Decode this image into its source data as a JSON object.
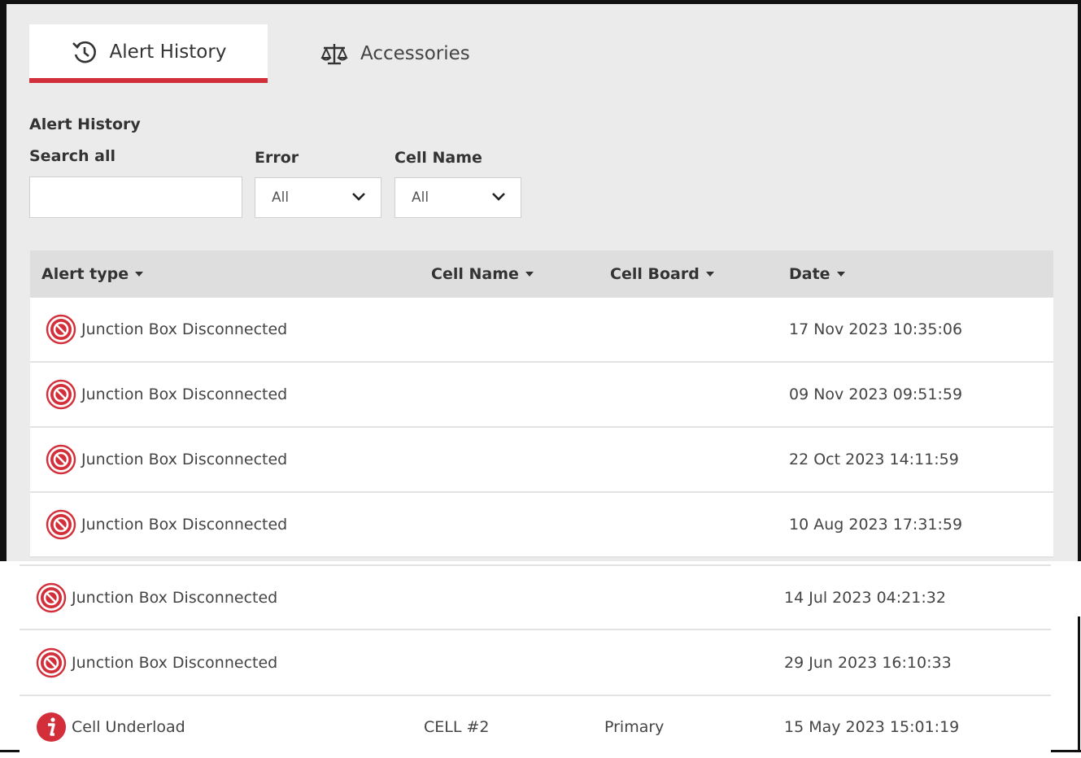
{
  "tabs": [
    {
      "label": "Alert History",
      "icon": "history-icon",
      "active": true
    },
    {
      "label": "Accessories",
      "icon": "scale-icon",
      "active": false
    }
  ],
  "section_title": "Alert History",
  "filters": {
    "search_label": "Search all",
    "search_value": "",
    "error_label": "Error",
    "error_value": "All",
    "cell_name_label": "Cell Name",
    "cell_name_value": "All"
  },
  "table": {
    "columns": [
      "Alert type",
      "Cell Name",
      "Cell Board",
      "Date"
    ],
    "rows": [
      {
        "alert_type": "Junction Box Disconnected",
        "icon": "disconnected-icon",
        "cell_name": "",
        "cell_board": "",
        "date": "17 Nov 2023 10:35:06"
      },
      {
        "alert_type": "Junction Box Disconnected",
        "icon": "disconnected-icon",
        "cell_name": "",
        "cell_board": "",
        "date": "09 Nov 2023 09:51:59"
      },
      {
        "alert_type": "Junction Box Disconnected",
        "icon": "disconnected-icon",
        "cell_name": "",
        "cell_board": "",
        "date": "22 Oct 2023 14:11:59"
      },
      {
        "alert_type": "Junction Box Disconnected",
        "icon": "disconnected-icon",
        "cell_name": "",
        "cell_board": "",
        "date": "10 Aug 2023 17:31:59"
      },
      {
        "alert_type": "Junction Box Disconnected",
        "icon": "disconnected-icon",
        "cell_name": "",
        "cell_board": "",
        "date": "14 Jul 2023 04:21:32"
      },
      {
        "alert_type": "Junction Box Disconnected",
        "icon": "disconnected-icon",
        "cell_name": "",
        "cell_board": "",
        "date": "29 Jun 2023 16:10:33"
      },
      {
        "alert_type": "Cell Underload",
        "icon": "info-icon",
        "cell_name": "CELL #2",
        "cell_board": "Primary",
        "date": "15 May 2023 15:01:19"
      }
    ]
  },
  "colors": {
    "accent": "#d32f3a",
    "panel_bg": "#ebebeb",
    "header_bg": "#dedede"
  }
}
